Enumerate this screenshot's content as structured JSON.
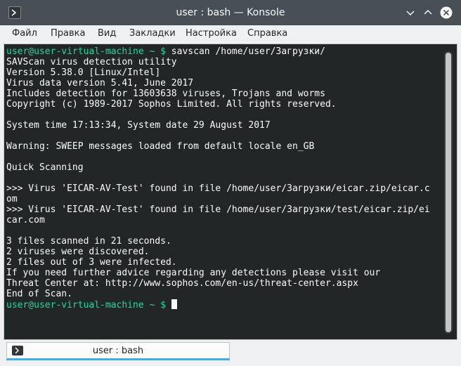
{
  "window": {
    "title": "user : bash — Konsole",
    "icons": [
      "konsole-icon",
      "minimize-icon",
      "maximize-icon",
      "close-icon"
    ]
  },
  "menu": [
    "Файл",
    "Правка",
    "Вид",
    "Закладки",
    "Настройка",
    "Справка"
  ],
  "terminal": {
    "prompt": "user@user-virtual-machine ~ $",
    "command": " savscan /home/user/Загрузки/",
    "output": [
      "SAVScan virus detection utility",
      "Version 5.38.0 [Linux/Intel]",
      "Virus data version 5.41, June 2017",
      "Includes detection for 13603638 viruses, Trojans and worms",
      "Copyright (c) 1989-2017 Sophos Limited. All rights reserved.",
      "",
      "System time 17:13:34, System date 29 August 2017",
      "",
      "Warning: SWEEP messages loaded from default locale en_GB",
      "",
      "Quick Scanning",
      "",
      ">>> Virus 'EICAR-AV-Test' found in file /home/user/Загрузки/eicar.zip/eicar.c",
      "om",
      ">>> Virus 'EICAR-AV-Test' found in file /home/user/Загрузки/test/eicar.zip/ei",
      "car.com",
      "",
      "3 files scanned in 21 seconds.",
      "2 viruses were discovered.",
      "2 files out of 3 were infected.",
      "If you need further advice regarding any detections please visit our",
      "Threat Center at: http://www.sophos.com/en-us/threat-center.aspx",
      "End of Scan."
    ],
    "final_prompt": "user@user-virtual-machine ~ $",
    "final_after": " "
  },
  "tabbar": {
    "tab_label": "user : bash"
  },
  "colors": {
    "titlebar": "#475057",
    "terminal_bg": "#232627",
    "terminal_fg": "#fcfcfc",
    "prompt": "#1cdc9a",
    "tab_accent": "#3daee9"
  }
}
